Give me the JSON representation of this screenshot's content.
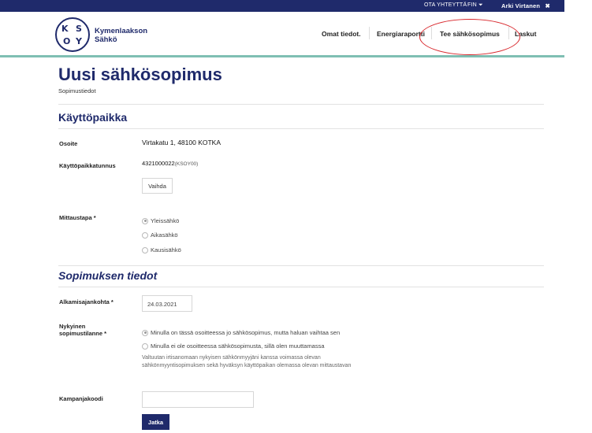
{
  "top_bar": {
    "contact_link": "OTA YHTEYTTÄ",
    "language": "FIN",
    "language_caret": "⏷",
    "user_name": "Arki Virtanen",
    "close_glyph": "✖"
  },
  "logo": {
    "letters": [
      "K",
      "S",
      "O",
      "Y"
    ],
    "name_line1": "Kymenlaakson",
    "name_line2": "Sähkö"
  },
  "nav": {
    "items": [
      "Omat tiedot.",
      "Energiaraportti",
      "Tee sähkösopimus",
      "Laskut"
    ],
    "highlight_color": "#d8262b"
  },
  "page": {
    "title": "Uusi sähkösopimus",
    "subtitle": "Sopimustiedot"
  },
  "usage_place": {
    "section_title": "Käyttöpaikka",
    "address_label": "Osoite",
    "address_value": "Virtakatu 1, 48100 KOTKA",
    "id_label": "Käyttöpaikkatunnus",
    "id_value": "4321000022",
    "id_suffix": "(KSOY00)",
    "change_button": "Vaihda",
    "metering_label": "Mittaustapa *",
    "metering_options": [
      "Yleissähkö",
      "Aikasähkö",
      "Kausisähkö"
    ],
    "metering_selected": 0
  },
  "contract": {
    "section_title": "Sopimuksen tiedot",
    "start_label": "Alkamisajankohta *",
    "start_value": "24.03.2021",
    "situation_label": "Nykyinen sopimustilanne *",
    "situation_options": [
      "Minulla on tässä osoitteessa jo sähkösopimus, mutta haluan vaihtaa sen",
      "Minulla ei ole osoitteessa sähkösopimusta, sillä olen muuttamassa"
    ],
    "situation_selected": 0,
    "authorization_note": "Valtuutan irtisanomaan nykyisen sähkönmyyjäni kanssa voimassa olevan sähkönmyyntisopimuksen sekä hyväksyn käyttöpaikan olemassa olevan mittaustavan",
    "campaign_label": "Kampanjakoodi",
    "campaign_value": "",
    "continue_button": "Jatka"
  },
  "colors": {
    "brand_navy": "#1f2a6b",
    "accent_teal": "#7fbfb3"
  }
}
